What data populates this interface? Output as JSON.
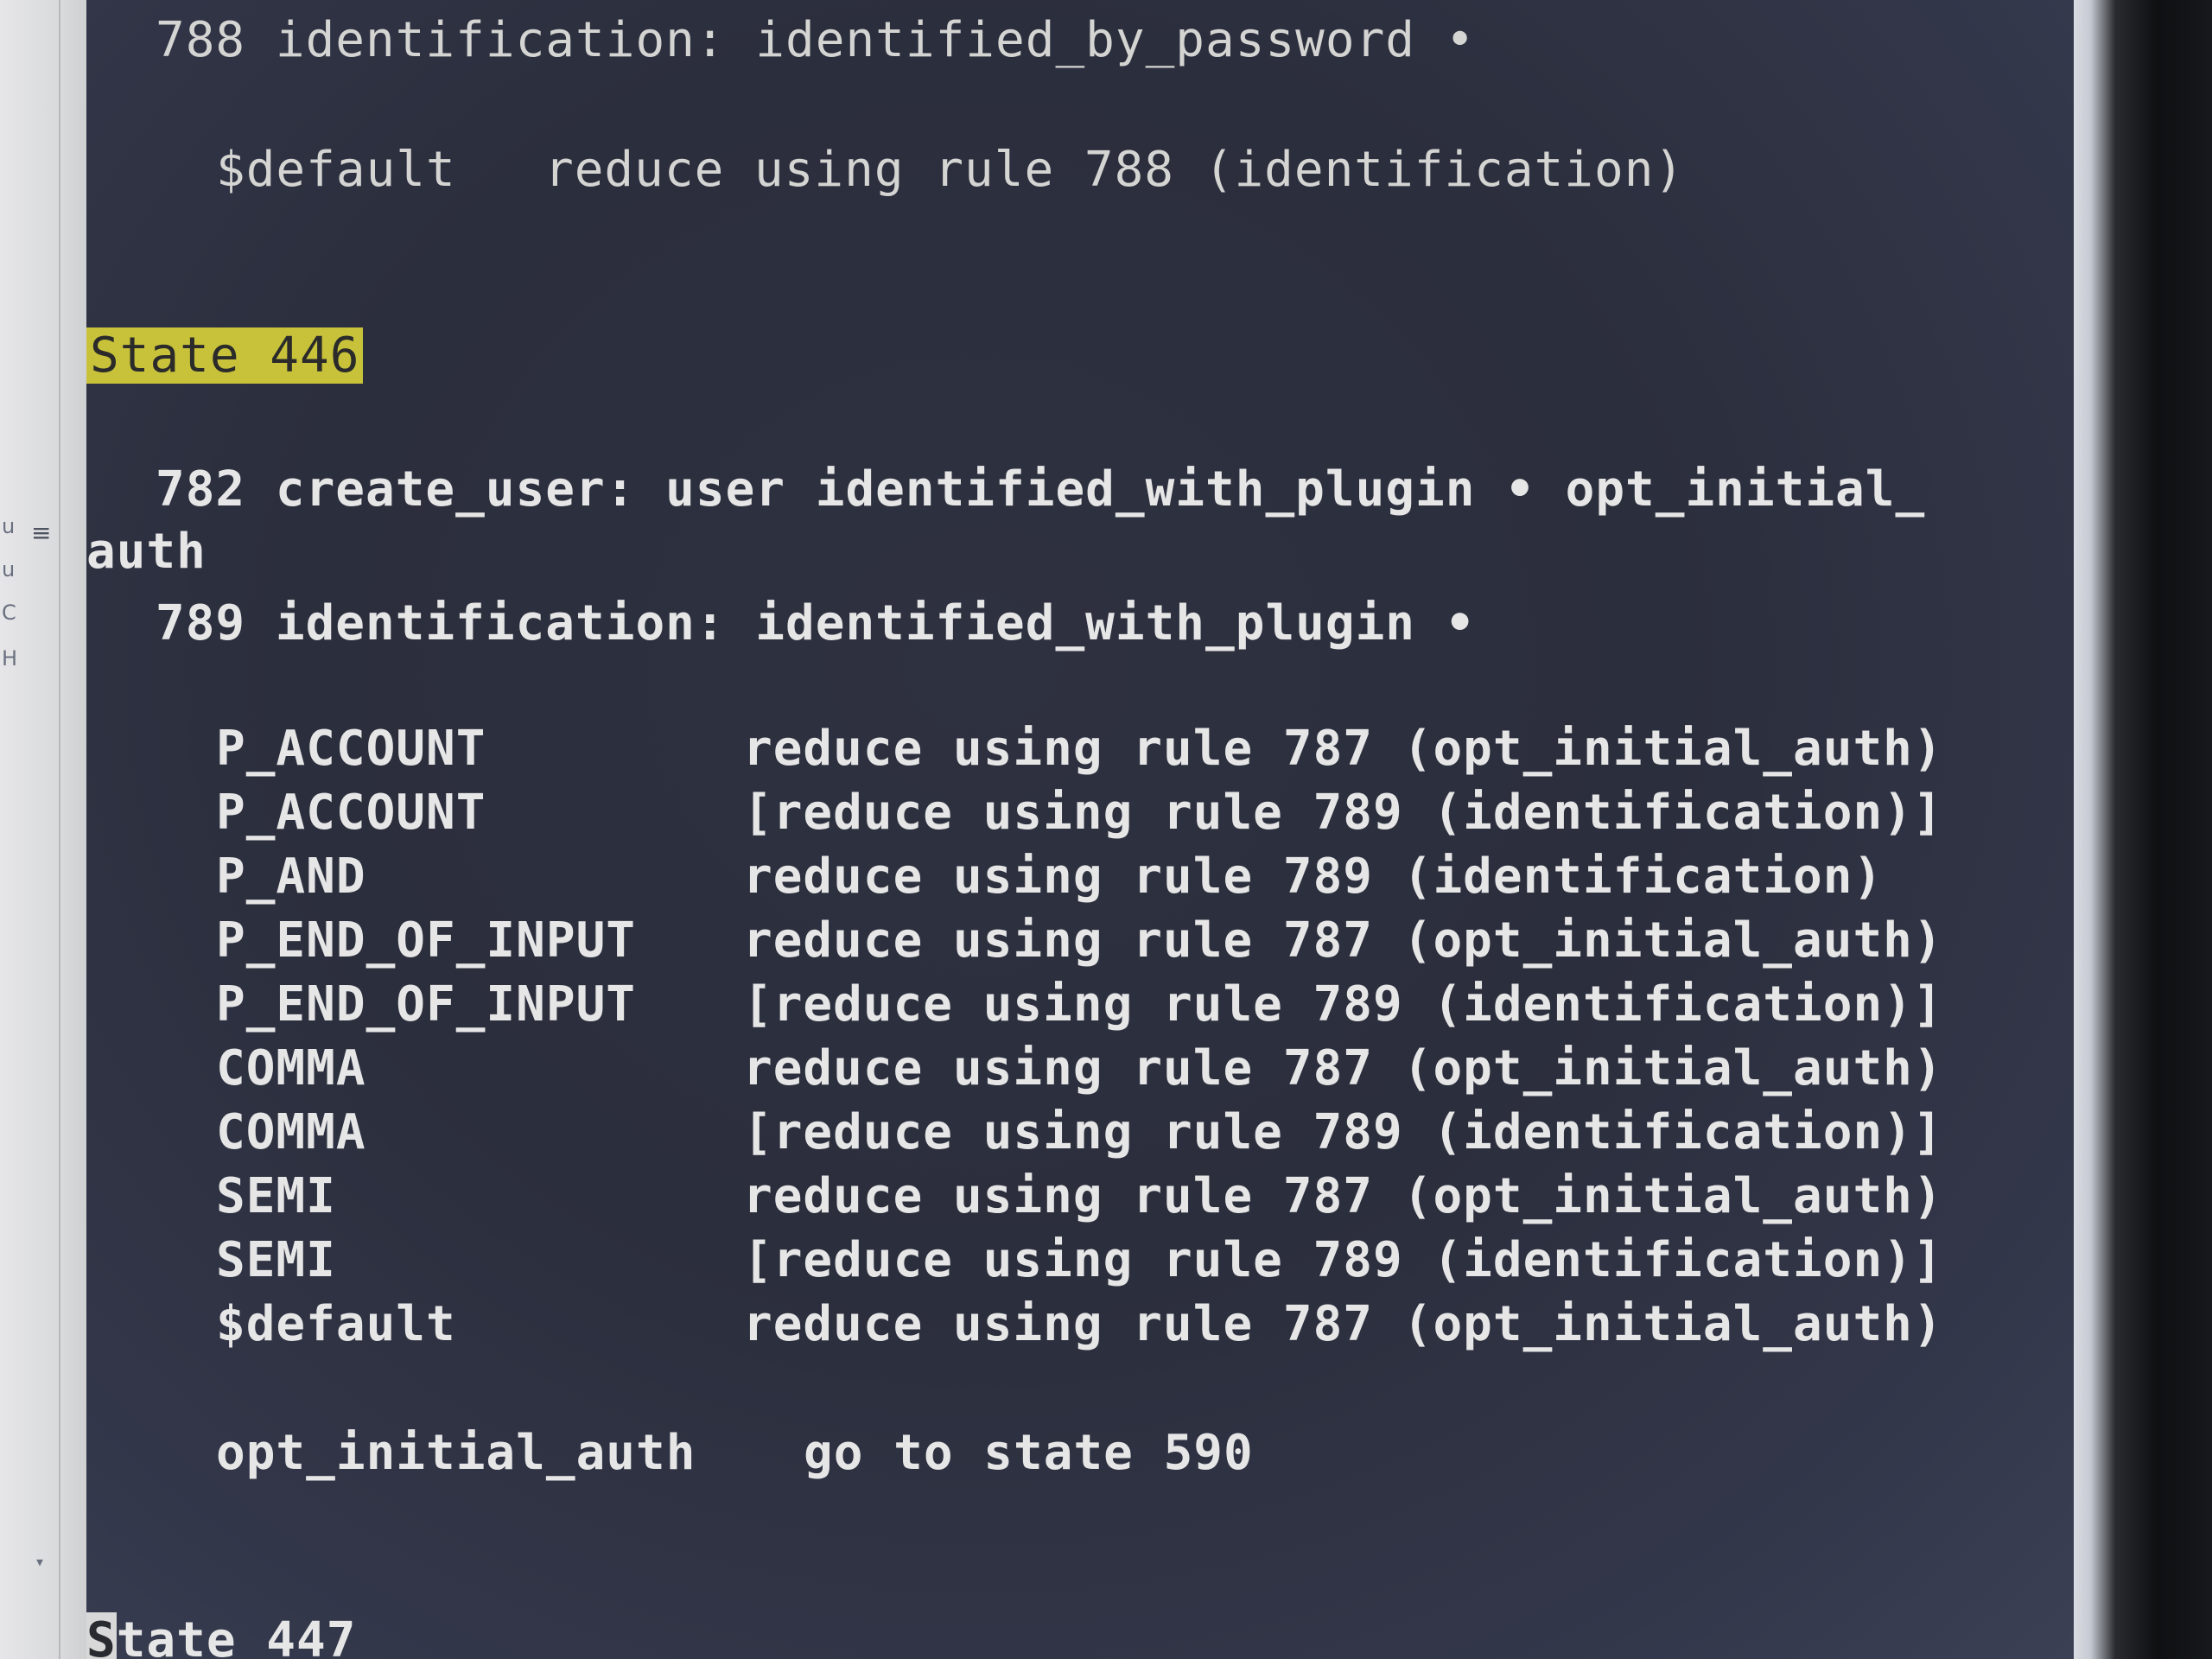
{
  "sidebar": {
    "fragments": [
      "u",
      "u",
      "C",
      "H"
    ],
    "menu_icon": "hamburger-menu-icon"
  },
  "editor": {
    "line_prev_rule": "788 identification: identified_by_password •",
    "line_prev_default_sym": "$default",
    "line_prev_default_action": "reduce using rule 788 (identification)",
    "state_446_header": "State 446",
    "item_782_a": "782 create_user: user identified_with_plugin • opt_initial_",
    "item_782_b": "auth",
    "item_789": "789 identification: identified_with_plugin •",
    "actions": [
      {
        "symbol": "P_ACCOUNT",
        "action": "reduce using rule 787 (opt_initial_auth)"
      },
      {
        "symbol": "P_ACCOUNT",
        "action": "[reduce using rule 789 (identification)]"
      },
      {
        "symbol": "P_AND",
        "action": "reduce using rule 789 (identification)"
      },
      {
        "symbol": "P_END_OF_INPUT",
        "action": "reduce using rule 787 (opt_initial_auth)"
      },
      {
        "symbol": "P_END_OF_INPUT",
        "action": "[reduce using rule 789 (identification)]"
      },
      {
        "symbol": "COMMA",
        "action": "reduce using rule 787 (opt_initial_auth)"
      },
      {
        "symbol": "COMMA",
        "action": "[reduce using rule 789 (identification)]"
      },
      {
        "symbol": "SEMI",
        "action": "reduce using rule 787 (opt_initial_auth)"
      },
      {
        "symbol": "SEMI",
        "action": "[reduce using rule 789 (identification)]"
      },
      {
        "symbol": "$default",
        "action": "reduce using rule 787 (opt_initial_auth)"
      }
    ],
    "goto_symbol": "opt_initial_auth",
    "goto_action": "go to state 590",
    "state_447_first_char": "S",
    "state_447_rest": "tate 447"
  }
}
